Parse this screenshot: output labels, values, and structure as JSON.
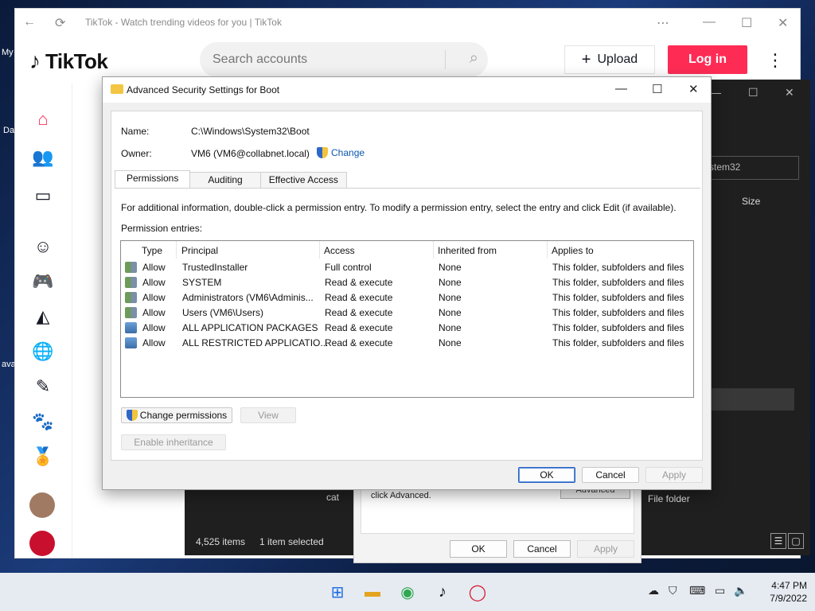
{
  "desktop": {
    "label_my": "My",
    "label_da": "Da",
    "label_ava": "ava"
  },
  "browser": {
    "tab_title": "TikTok - Watch trending videos for you | TikTok",
    "logo_text": "TikTok",
    "search_placeholder": "Search accounts",
    "upload_label": "Upload",
    "login_label": "Log in",
    "sidebar_icons": [
      "home-icon",
      "following-icon",
      "live-icon",
      "comedy-icon",
      "gaming-icon",
      "food-icon",
      "travel-icon",
      "beauty-icon",
      "animals-icon",
      "sports-icon"
    ]
  },
  "explorer": {
    "search_text": "stem32",
    "size_header": "Size",
    "items_count": "4,525 items",
    "selected": "1 item selected",
    "folder_row": "cat",
    "file_type": "File folder"
  },
  "properties": {
    "text": "click Advanced.",
    "advanced_btn": "Advanced",
    "ok": "OK",
    "cancel": "Cancel",
    "apply": "Apply"
  },
  "dialog": {
    "title": "Advanced Security Settings for Boot",
    "name_label": "Name:",
    "name_value": "C:\\Windows\\System32\\Boot",
    "owner_label": "Owner:",
    "owner_value": "VM6 (VM6@collabnet.local)",
    "change_label": "Change",
    "tabs": [
      "Permissions",
      "Auditing",
      "Effective Access"
    ],
    "info": "For additional information, double-click a permission entry. To modify a permission entry, select the entry and click Edit (if available).",
    "entries_label": "Permission entries:",
    "columns": [
      "Type",
      "Principal",
      "Access",
      "Inherited from",
      "Applies to"
    ],
    "rows": [
      {
        "type": "Allow",
        "principal": "TrustedInstaller",
        "access": "Full control",
        "inherited": "None",
        "applies": "This folder, subfolders and files"
      },
      {
        "type": "Allow",
        "principal": "SYSTEM",
        "access": "Read & execute",
        "inherited": "None",
        "applies": "This folder, subfolders and files"
      },
      {
        "type": "Allow",
        "principal": "Administrators (VM6\\Adminis...",
        "access": "Read & execute",
        "inherited": "None",
        "applies": "This folder, subfolders and files"
      },
      {
        "type": "Allow",
        "principal": "Users (VM6\\Users)",
        "access": "Read & execute",
        "inherited": "None",
        "applies": "This folder, subfolders and files"
      },
      {
        "type": "Allow",
        "principal": "ALL APPLICATION PACKAGES",
        "access": "Read & execute",
        "inherited": "None",
        "applies": "This folder, subfolders and files"
      },
      {
        "type": "Allow",
        "principal": "ALL RESTRICTED APPLICATIO...",
        "access": "Read & execute",
        "inherited": "None",
        "applies": "This folder, subfolders and files"
      }
    ],
    "change_permissions": "Change permissions",
    "view": "View",
    "enable_inheritance": "Enable inheritance",
    "ok": "OK",
    "cancel": "Cancel",
    "apply": "Apply"
  },
  "taskbar": {
    "time": "4:47 PM",
    "date": "7/9/2022"
  },
  "colors": {
    "tiktok_red": "#fe2c55",
    "link_blue": "#0a58b0",
    "taskbar": "#e6ebf2"
  }
}
